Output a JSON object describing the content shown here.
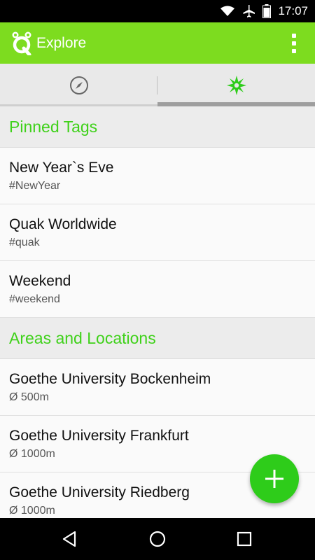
{
  "status_bar": {
    "time": "17:07"
  },
  "app_bar": {
    "title": "Explore"
  },
  "tabs": [
    {
      "icon": "compass-icon",
      "selected": false
    },
    {
      "icon": "star-burst-icon",
      "selected": true
    }
  ],
  "sections": [
    {
      "header": "Pinned Tags",
      "items": [
        {
          "title": "New Year`s Eve",
          "subtitle": "#NewYear"
        },
        {
          "title": "Quak Worldwide",
          "subtitle": "#quak"
        },
        {
          "title": "Weekend",
          "subtitle": "#weekend"
        }
      ]
    },
    {
      "header": "Areas and Locations",
      "items": [
        {
          "title": "Goethe University Bockenheim",
          "subtitle": "Ø 500m"
        },
        {
          "title": "Goethe University Frankfurt",
          "subtitle": "Ø 1000m"
        },
        {
          "title": "Goethe University Riedberg",
          "subtitle": "Ø 1000m"
        }
      ]
    }
  ],
  "colors": {
    "app_bar": "#7ddc1f",
    "accent_text": "#3fd11a",
    "fab": "#2ecc1a"
  }
}
